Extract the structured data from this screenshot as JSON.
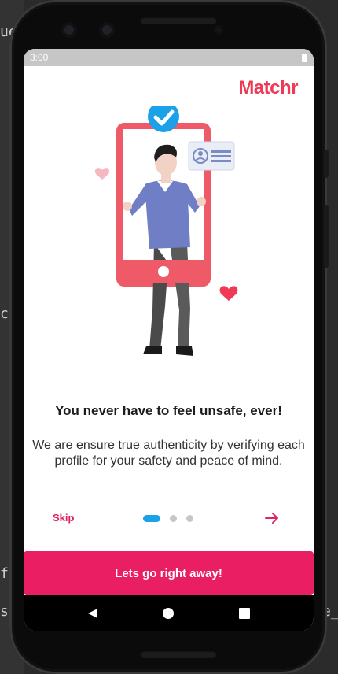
{
  "status_bar": {
    "time": "3:00"
  },
  "app": {
    "brand": "Matchr"
  },
  "onboarding": {
    "heading": "You never have to feel unsafe, ever!",
    "description": "We are ensure true authenticity by verifying each profile for your safety and peace of mind.",
    "skip_label": "Skip",
    "current_page": 1,
    "page_count": 3,
    "cta_label": "Lets go right away!"
  },
  "colors": {
    "brand": "#ee3a55",
    "cta": "#e91e63",
    "dot_active": "#1aa1e8",
    "dot_inactive": "#c7c7c7"
  },
  "icons": {
    "next": "arrow-right-icon",
    "verified": "check-badge-icon",
    "nav_back": "back-triangle-icon",
    "nav_home": "home-circle-icon",
    "nav_recents": "recents-square-icon"
  },
  "background": {
    "left_fragments": [
      "ue",
      "c",
      "f/",
      "s"
    ],
    "right_fragments": [
      "e_"
    ]
  }
}
